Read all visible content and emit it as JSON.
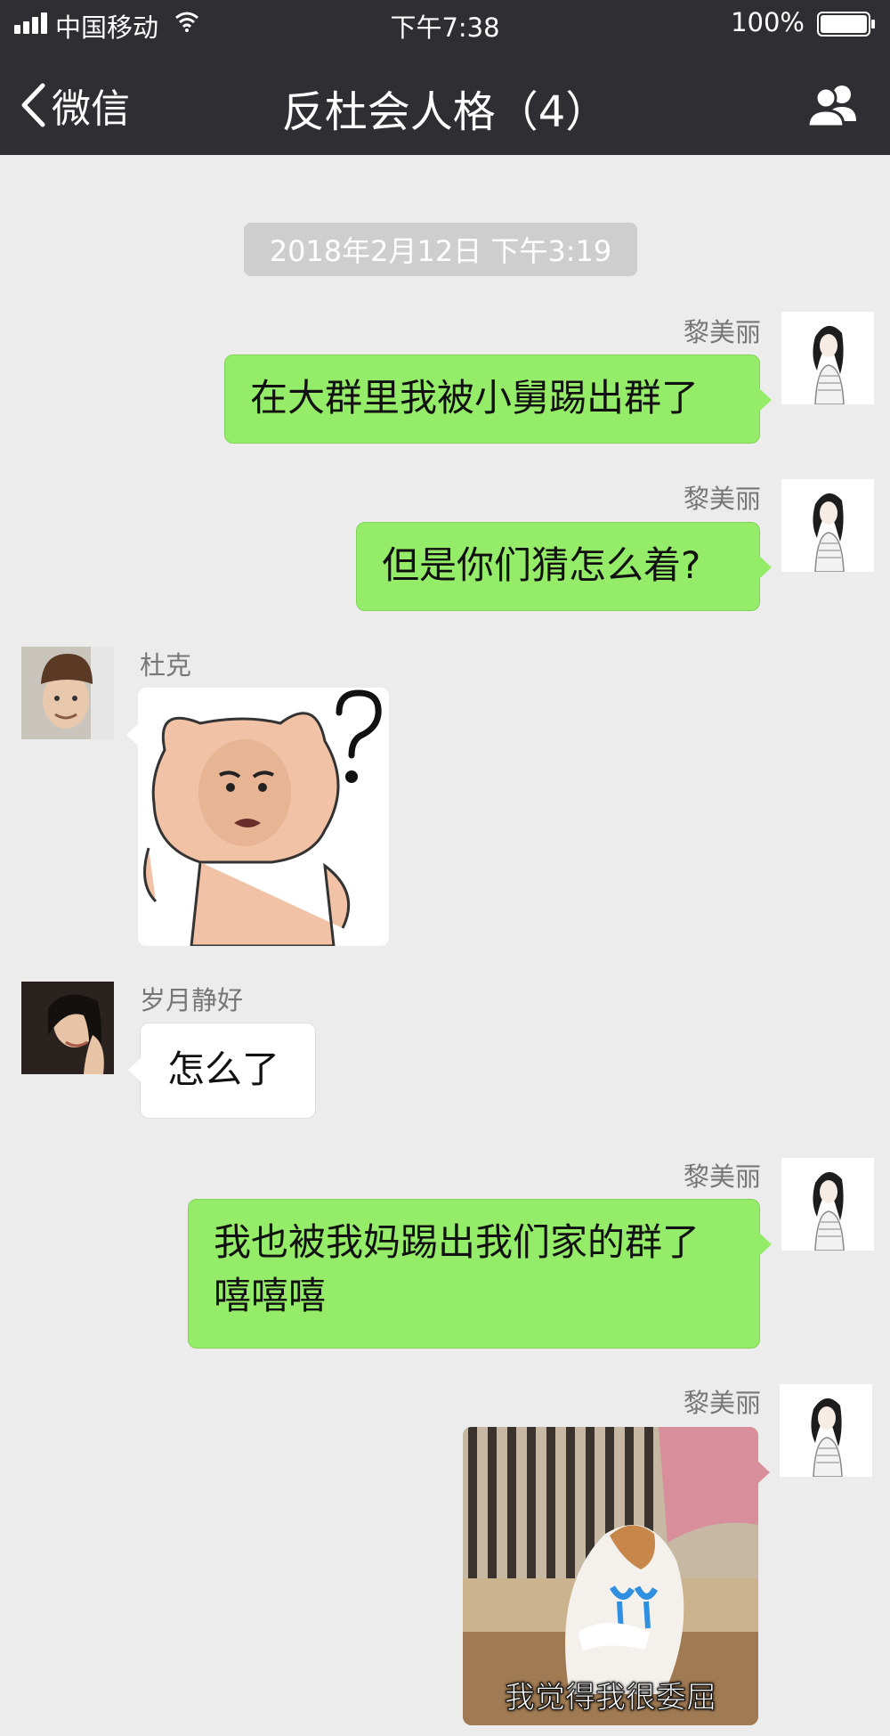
{
  "status_bar": {
    "carrier": "中国移动",
    "time": "下午7:38",
    "battery_percent": "100%",
    "battery_level": 1.0
  },
  "nav": {
    "back_label": "微信",
    "title": "反杜会人格（4）",
    "members_icon": "people-icon"
  },
  "chat": {
    "timestamp": "2018年2月12日 下午3:19",
    "messages": [
      {
        "sender": "黎美丽",
        "side": "right",
        "type": "text",
        "text": "在大群里我被小舅踢出群了"
      },
      {
        "sender": "黎美丽",
        "side": "right",
        "type": "text",
        "text": "但是你们猜怎么着?"
      },
      {
        "sender": "杜克",
        "side": "left",
        "type": "sticker",
        "sticker": "confused-pig-face-question-mark"
      },
      {
        "sender": "岁月静好",
        "side": "left",
        "type": "text",
        "text": "怎么了"
      },
      {
        "sender": "黎美丽",
        "side": "right",
        "type": "text",
        "lines": [
          "我也被我妈踢出我们家的群了",
          "嘻嘻嘻"
        ]
      },
      {
        "sender": "黎美丽",
        "side": "right",
        "type": "sticker",
        "sticker": "crying-cat",
        "caption": "我觉得我很委屈"
      }
    ]
  },
  "colors": {
    "nav_bg": "#2e2e33",
    "chat_bg": "#ececec",
    "my_bubble": "#95ec69",
    "other_bubble": "#ffffff"
  }
}
